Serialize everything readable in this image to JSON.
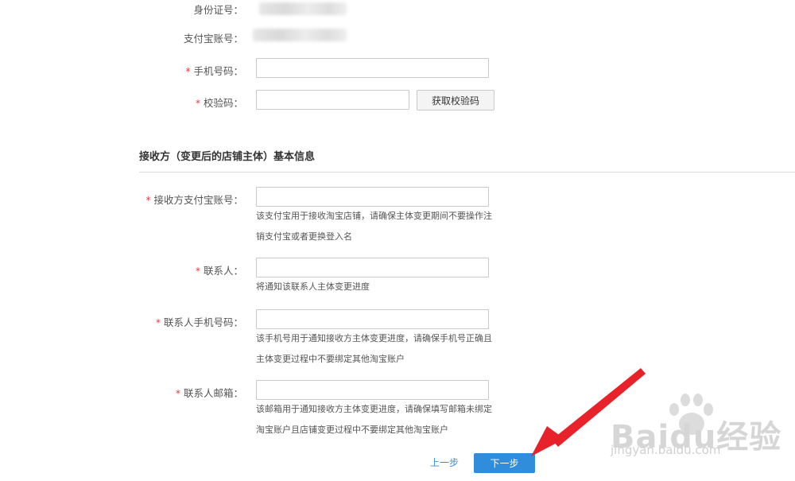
{
  "identity": {
    "id_number_label": "身份证号：",
    "alipay_account_label": "支付宝账号："
  },
  "verify": {
    "required_mark": "*",
    "phone_label": "手机号码：",
    "phone_value": "",
    "code_label": "校验码：",
    "code_value": "",
    "get_code_button": "获取校验码"
  },
  "receiver_section": {
    "title": "接收方（变更后的店铺主体）基本信息",
    "fields": [
      {
        "label": "接收方支付宝账号：",
        "value": "",
        "hint_lines": [
          "该支付宝用于接收淘宝店铺，请确保主体变更期间不要操作注",
          "销支付宝或者更换登入名"
        ]
      },
      {
        "label": "联系人：",
        "value": "",
        "hint_lines": [
          "将通知该联系人主体变更进度"
        ]
      },
      {
        "label": "联系人手机号码：",
        "value": "",
        "hint_lines": [
          "该手机号用于通知接收方主体变更进度，请确保手机号正确且",
          "主体变更过程中不要绑定其他淘宝账户"
        ]
      },
      {
        "label": "联系人邮箱：",
        "value": "",
        "hint_lines": [
          "该邮箱用于通知接收方主体变更进度，请确保填写邮箱未绑定",
          "淘宝账户且店铺变更过程中不要绑定其他淘宝账户"
        ]
      }
    ]
  },
  "footer": {
    "prev_label": "上一步",
    "next_label": "下一步"
  },
  "annotation": {
    "arrow_color": "#e8222a"
  },
  "watermark": {
    "logo_text": "Baidu经验",
    "url_text": "jingyan.baidu.com"
  },
  "colors": {
    "required": "#e4393c",
    "primary_button": "#2f8ddb",
    "link": "#3b8cd6"
  }
}
